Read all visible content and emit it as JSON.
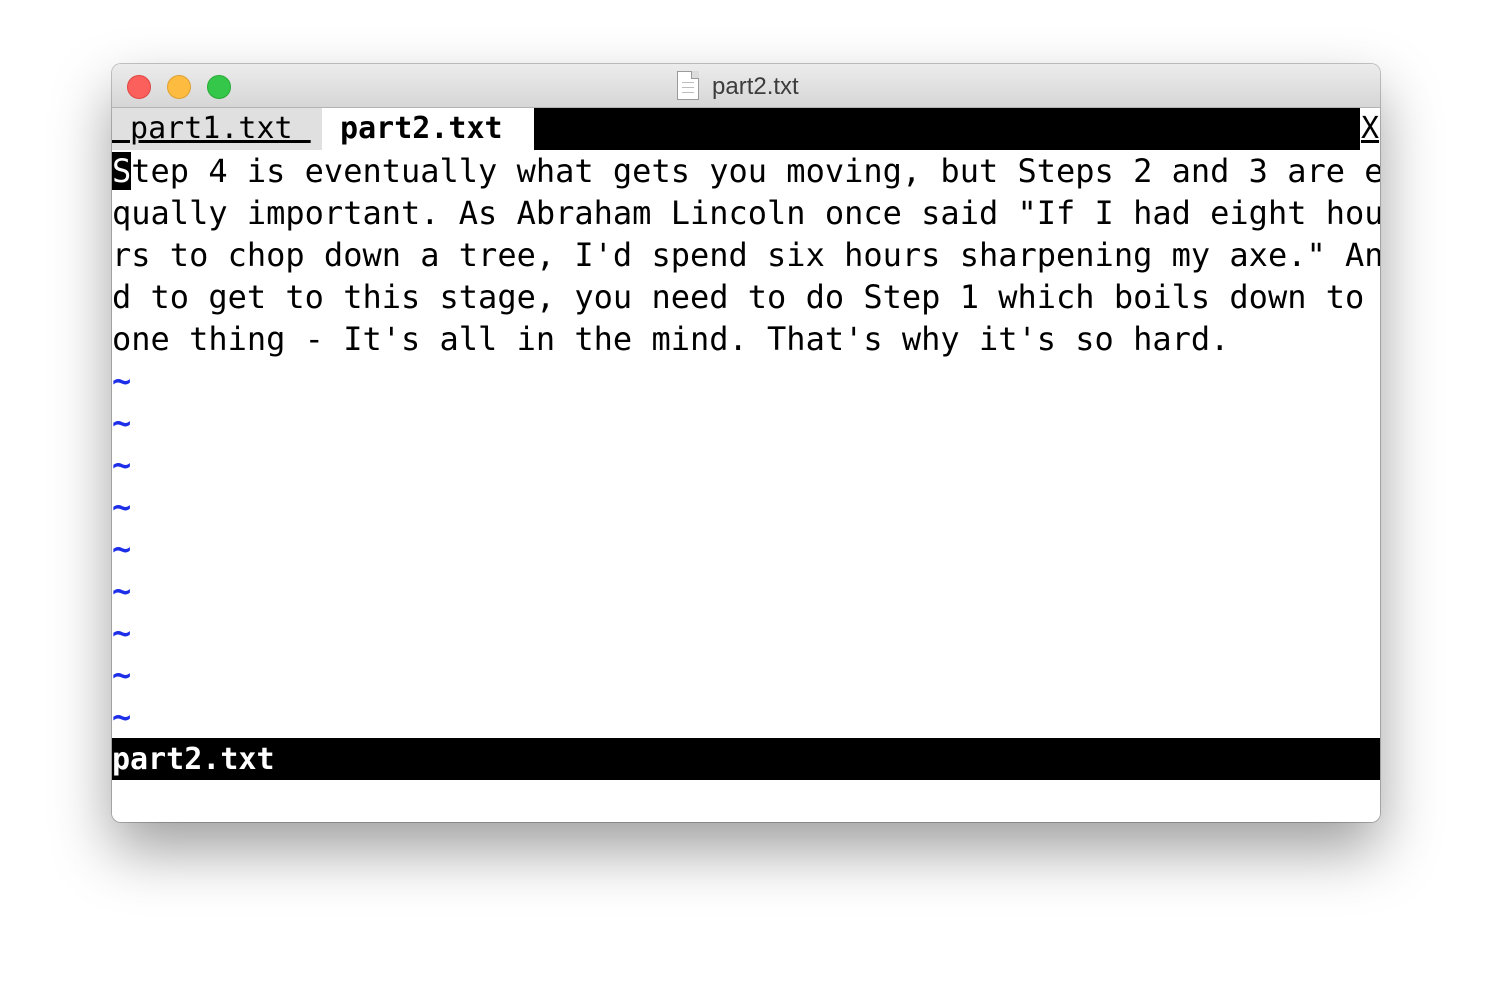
{
  "window": {
    "title": "part2.txt",
    "icon": "document-icon"
  },
  "tabs": [
    {
      "label": " part1.txt ",
      "active": false
    },
    {
      "label": " part2.txt ",
      "active": true
    }
  ],
  "tab_close_label": "X",
  "buffer": {
    "lines": [
      "tep 4 is eventually what gets you moving, but Steps 2 and 3 are e",
      "qually important. As Abraham Lincoln once said \"If I had eight hou",
      "rs to chop down a tree, I'd spend six hours sharpening my axe.\" An",
      "d to get to this stage, you need to do Step 1 which boils down to ",
      "one thing - It's all in the mind. That's why it's so hard."
    ],
    "cursor_char": "S",
    "tilde": "~"
  },
  "statusline": "part2.txt",
  "colors": {
    "tilde": "#1d2ee8",
    "statusline_bg": "#000000",
    "tabline_bg": "#000000"
  }
}
